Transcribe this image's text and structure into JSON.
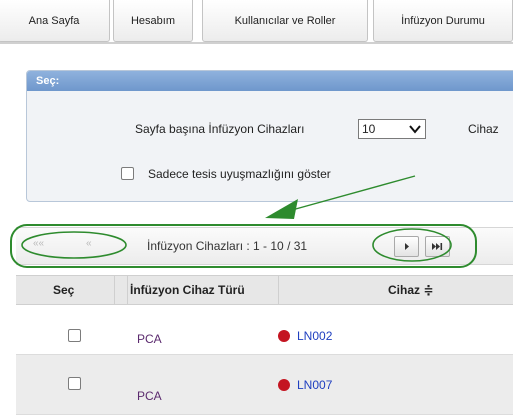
{
  "tabs": [
    {
      "label": "Ana Sayfa"
    },
    {
      "label": "Hesabım"
    },
    {
      "label": "Kullanıcılar ve Roller"
    },
    {
      "label": "İnfüzyon Durumu"
    }
  ],
  "panel": {
    "title": "Seç:",
    "per_page_label": "Sayfa başına İnfüzyon Cihazları",
    "per_page_value": "10",
    "device_label_partial": "Cihaz",
    "checkbox_label": "Sadece tesis uyuşmazlığını göster"
  },
  "pager": {
    "first_label": "««",
    "prev_label": "«",
    "summary": "İnfüzyon Cihazları : 1 - 10 / 31"
  },
  "table": {
    "headers": {
      "select": "Seç",
      "type": "İnfüzyon Cihaz Türü",
      "device": "Cihaz ≑"
    },
    "rows": [
      {
        "type": "PCA",
        "device": "LN002",
        "status_color": "#c41521"
      },
      {
        "type": "PCA",
        "device": "LN007",
        "status_color": "#c41521"
      }
    ]
  },
  "colors": {
    "annotation_green": "#2e8b2e",
    "panel_header": "#7aa1d3",
    "status_red": "#c41521",
    "link_blue": "#1f3fc0"
  }
}
